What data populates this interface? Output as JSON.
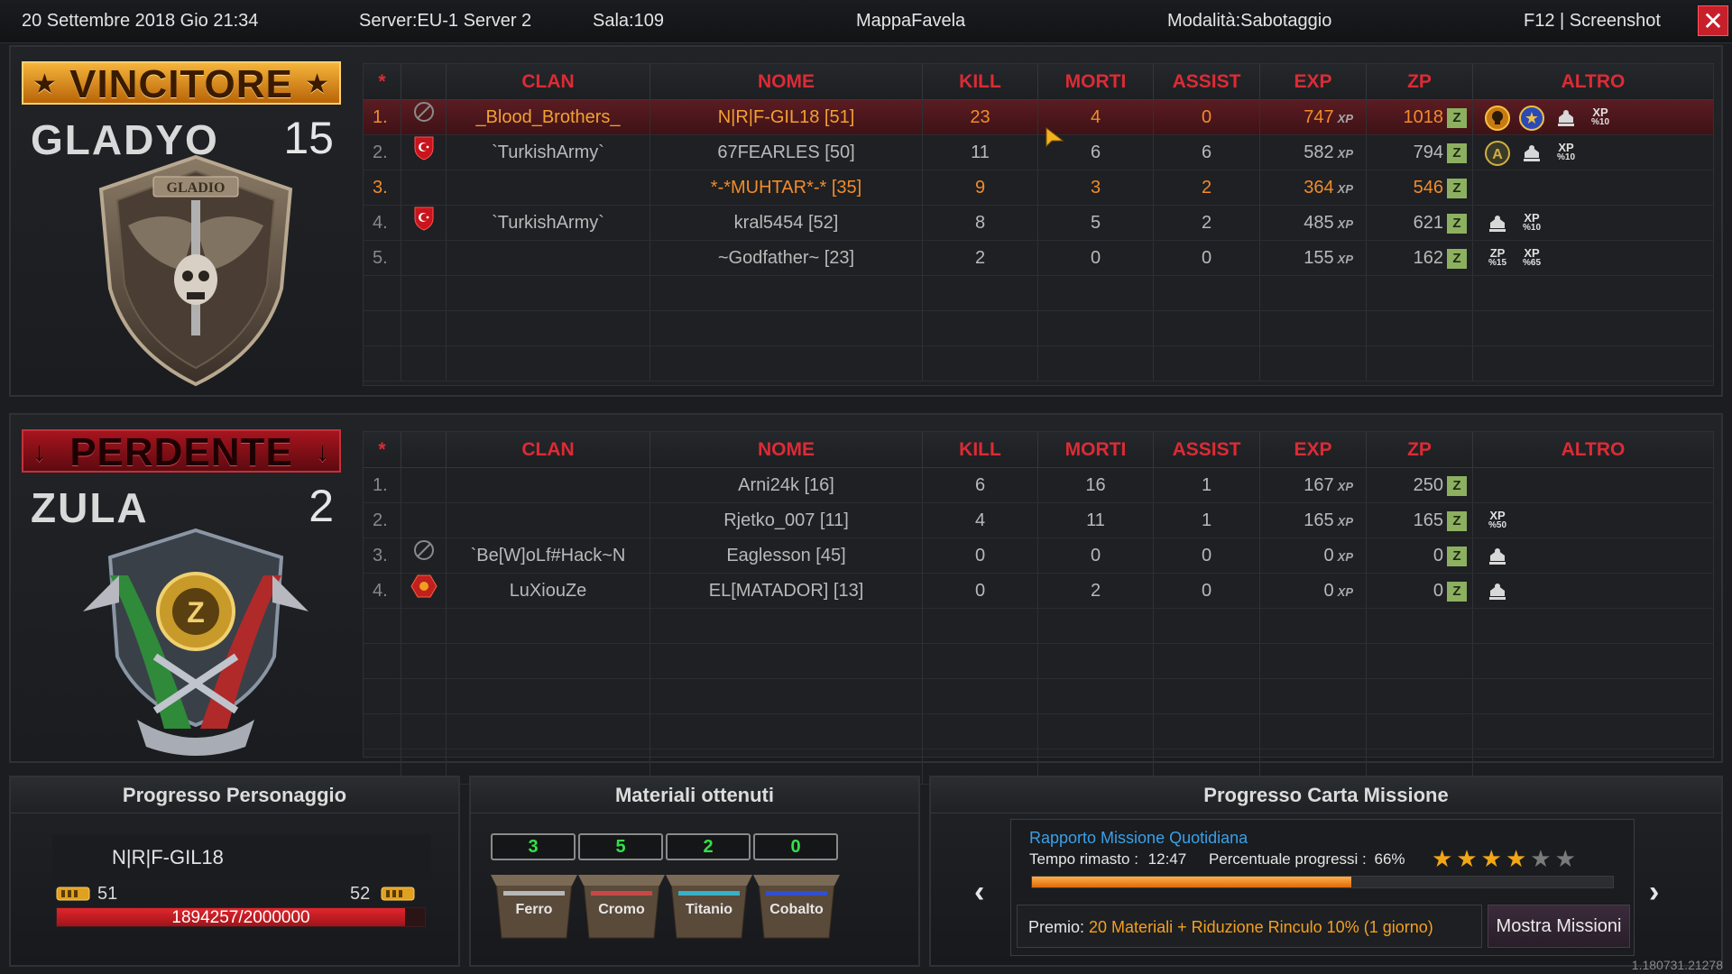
{
  "topbar": {
    "datetime": "20 Settembre 2018 Gio 21:34",
    "server": "Server:EU-1 Server 2",
    "room": "Sala:109",
    "map": "MappaFavela",
    "mode": "Modalità:Sabotaggio",
    "screenshot": "F12 | Screenshot",
    "close": "✕"
  },
  "headers": {
    "star": "*",
    "clan": "CLAN",
    "name": "NOME",
    "kill": "KILL",
    "deaths": "MORTI",
    "assist": "ASSIST",
    "exp": "EXP",
    "zp": "ZP",
    "other": "ALTRO"
  },
  "winner": {
    "banner": "VINCITORE",
    "team": "GLADYO",
    "score": "15",
    "emblem_text": "GLADIO",
    "rows": [
      {
        "num": "1.",
        "clan": "_Blood_Brothers_",
        "clan_icon": "ban-icon",
        "name": "N|R|F-GIL18 [51]",
        "kill": "23",
        "deaths": "4",
        "assist": "0",
        "exp": "747",
        "zp": "1018",
        "perks": [
          "skull-badge-icon",
          "star-badge-icon",
          "rank-icon",
          "xp-bonus-10"
        ],
        "style": "highlight"
      },
      {
        "num": "2.",
        "clan": "`TurkishArmy`",
        "clan_icon": "turkish-shield-icon",
        "name": "67FEARLES [50]",
        "kill": "11",
        "deaths": "6",
        "assist": "6",
        "exp": "582",
        "zp": "794",
        "perks": [
          "a-badge-icon",
          "rank-icon",
          "xp-bonus-10"
        ],
        "style": "normal"
      },
      {
        "num": "3.",
        "clan": "",
        "clan_icon": "",
        "name": "*-*MUHTAR*-* [35]",
        "kill": "9",
        "deaths": "3",
        "assist": "2",
        "exp": "364",
        "zp": "546",
        "perks": [],
        "style": "orange"
      },
      {
        "num": "4.",
        "clan": "`TurkishArmy`",
        "clan_icon": "turkish-shield-icon",
        "name": "kral5454 [52]",
        "kill": "8",
        "deaths": "5",
        "assist": "2",
        "exp": "485",
        "zp": "621",
        "perks": [
          "rank-icon",
          "xp-bonus-10"
        ],
        "style": "normal"
      },
      {
        "num": "5.",
        "clan": "",
        "clan_icon": "",
        "name": "~Godfather~ [23]",
        "kill": "2",
        "deaths": "0",
        "assist": "0",
        "exp": "155",
        "zp": "162",
        "perks": [
          "zp-bonus-15",
          "xp-bonus-65"
        ],
        "style": "normal"
      }
    ]
  },
  "loser": {
    "banner": "PERDENTE",
    "team": "ZULA",
    "score": "2",
    "rows": [
      {
        "num": "1.",
        "clan": "",
        "clan_icon": "",
        "name": "Arni24k [16]",
        "kill": "6",
        "deaths": "16",
        "assist": "1",
        "exp": "167",
        "zp": "250",
        "perks": [],
        "style": "normal"
      },
      {
        "num": "2.",
        "clan": "",
        "clan_icon": "",
        "name": "Rjetko_007 [11]",
        "kill": "4",
        "deaths": "11",
        "assist": "1",
        "exp": "165",
        "zp": "165",
        "perks": [
          "xp-bonus-50"
        ],
        "style": "normal"
      },
      {
        "num": "3.",
        "clan": "`Be[W]oLf#Hack~N",
        "clan_icon": "ban-icon",
        "name": "Eaglesson [45]",
        "kill": "0",
        "deaths": "0",
        "assist": "0",
        "exp": "0",
        "zp": "0",
        "perks": [
          "rank-icon"
        ],
        "style": "normal"
      },
      {
        "num": "4.",
        "clan": "LuXiouZe",
        "clan_icon": "red-hex-icon",
        "name": "EL[MATADOR] [13]",
        "kill": "0",
        "deaths": "2",
        "assist": "0",
        "exp": "0",
        "zp": "0",
        "perks": [
          "rank-icon"
        ],
        "style": "normal"
      }
    ]
  },
  "perk_labels": {
    "xp-bonus-10": {
      "top": "XP",
      "bottom": "%10"
    },
    "xp-bonus-50": {
      "top": "XP",
      "bottom": "%50"
    },
    "xp-bonus-65": {
      "top": "XP",
      "bottom": "%65"
    },
    "zp-bonus-15": {
      "top": "ZP",
      "bottom": "%15"
    }
  },
  "xp_suffix": "XP",
  "zp_box": "Z",
  "character": {
    "title": "Progresso Personaggio",
    "name": "N|R|F-GIL18",
    "level_current": "51",
    "level_next": "52",
    "exp_text": "1894257/2000000",
    "exp_fraction": 0.947
  },
  "materials": {
    "title": "Materiali ottenuti",
    "items": [
      {
        "label": "Ferro",
        "count": "3",
        "color": "#b8b8b8"
      },
      {
        "label": "Cromo",
        "count": "5",
        "color": "#c84848"
      },
      {
        "label": "Titanio",
        "count": "2",
        "color": "#38b0c8"
      },
      {
        "label": "Cobalto",
        "count": "0",
        "color": "#3050d0"
      }
    ]
  },
  "mission": {
    "title": "Progresso Carta Missione",
    "report": "Rapporto Missione Quotidiana",
    "time_label": "Tempo rimasto :",
    "time_value": "12:47",
    "progress_label": "Percentuale progressi :",
    "progress_value": "66%",
    "progress_fraction": 0.55,
    "stars_on": 4,
    "stars_total": 6,
    "reward_label": "Premio:",
    "reward_value": "20 Materiali + Riduzione Rinculo 10% (1 giorno)",
    "button": "Mostra Missioni",
    "prev": "‹",
    "next": "›"
  },
  "version": "1.180731.21278"
}
